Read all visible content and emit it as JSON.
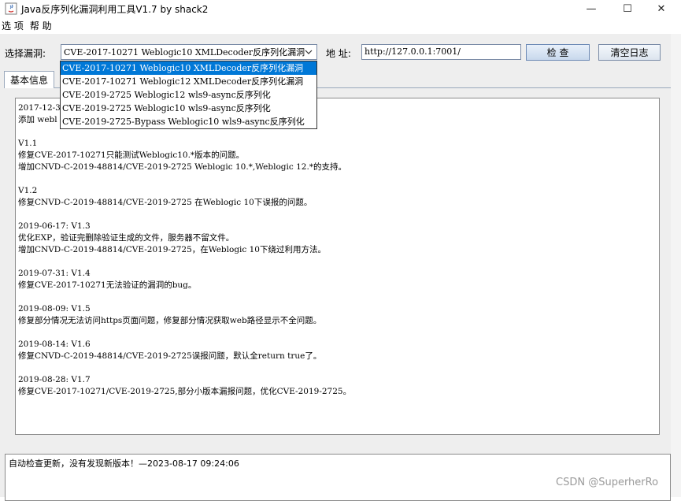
{
  "window": {
    "title": "Java反序列化漏洞利用工具V1.7 by shack2",
    "minimize_glyph": "—",
    "maximize_glyph": "☐",
    "close_glyph": "✕"
  },
  "menu": {
    "items": [
      "选 项",
      "帮 助"
    ]
  },
  "toolbar": {
    "vuln_label": "选择漏洞:",
    "selected_vuln": "CVE-2017-10271 Weblogic10 XMLDecoder反序列化漏洞",
    "address_label": "地 址:",
    "address_value": "http://127.0.0.1:7001/",
    "check_button": "检 查",
    "clear_log_button": "清空日志"
  },
  "dropdown": {
    "options": [
      "CVE-2017-10271 Weblogic10 XMLDecoder反序列化漏洞",
      "CVE-2017-10271 Weblogic12 XMLDecoder反序列化漏洞",
      "CVE-2019-2725 Weblogic12 wls9-async反序列化",
      "CVE-2019-2725 Weblogic10 wls9-async反序列化",
      "CVE-2019-2725-Bypass Weblogic10 wls9-async反序列化"
    ]
  },
  "tabs": {
    "basic_info": "基本信息"
  },
  "info": {
    "lines": [
      "2017-12-3",
      "添加 webl",
      "",
      "V1.1",
      "修复CVE-2017-10271只能测试Weblogic10.*版本的问题。",
      "增加CNVD-C-2019-48814/CVE-2019-2725 Weblogic 10.*,Weblogic 12.*的支持。",
      "",
      "V1.2",
      "修复CNVD-C-2019-48814/CVE-2019-2725 在Weblogic 10下误报的问题。",
      "",
      "2019-06-17: V1.3",
      "优化EXP，验证完删除验证生成的文件，服务器不留文件。",
      "增加CNVD-C-2019-48814/CVE-2019-2725，在Weblogic 10下绕过利用方法。",
      "",
      "2019-07-31: V1.4",
      "修复CVE-2017-10271无法验证的漏洞的bug。",
      "",
      "2019-08-09: V1.5",
      "修复部分情况无法访问https页面问题，修复部分情况获取web路径显示不全问题。",
      "",
      "2019-08-14: V1.6",
      "修复CNVD-C-2019-48814/CVE-2019-2725误报问题，默认全return true了。",
      "",
      "2019-08-28: V1.7",
      "修复CVE-2017-10271/CVE-2019-2725,部分小版本漏报问题，优化CVE-2019-2725。"
    ]
  },
  "log": {
    "text": "自动检查更新，没有发现新版本！—2023-08-17 09:24:06"
  },
  "watermark": "CSDN @SuperherRo",
  "colors": {
    "selection": "#0078d7",
    "panel": "#eeeeee"
  }
}
